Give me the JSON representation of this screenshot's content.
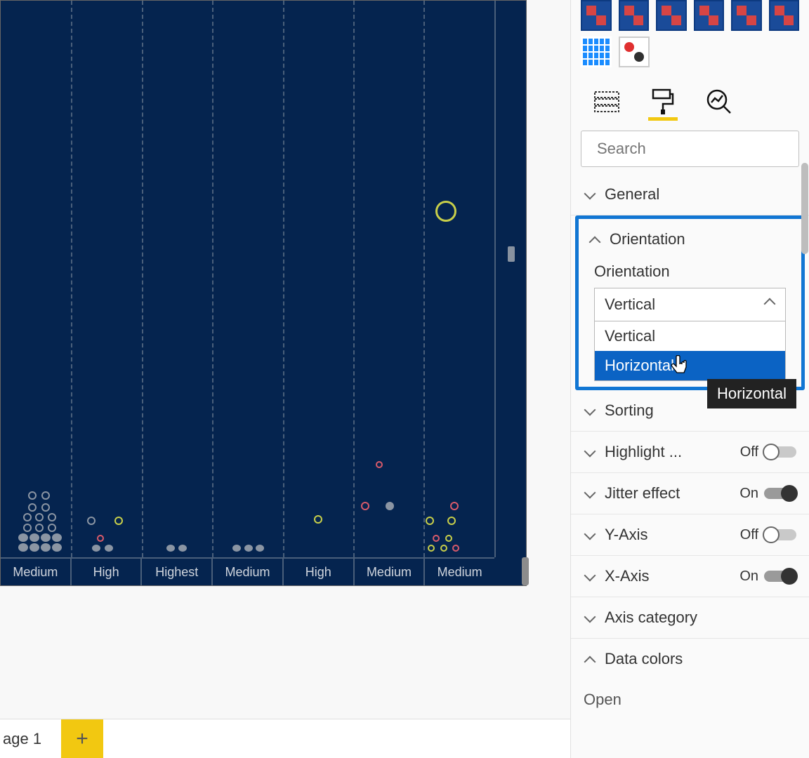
{
  "chart_data": {
    "type": "scatter",
    "title": "",
    "xlabel": "",
    "ylabel": "",
    "categories": [
      "Medium",
      "High",
      "Highest",
      "Medium",
      "High",
      "Medium",
      "Medium"
    ],
    "note": "Vertical strip/jitter plot; y positions approximate relative to full plot height (0=bottom, 1=top)",
    "series": [
      {
        "name": "grey",
        "color": "#8b95a3",
        "points": [
          {
            "cat": 0,
            "y": 0.022
          },
          {
            "cat": 0,
            "y": 0.022
          },
          {
            "cat": 0,
            "y": 0.022
          },
          {
            "cat": 0,
            "y": 0.022
          },
          {
            "cat": 0,
            "y": 0.04
          },
          {
            "cat": 0,
            "y": 0.04
          },
          {
            "cat": 0,
            "y": 0.04
          },
          {
            "cat": 0,
            "y": 0.04
          },
          {
            "cat": 0,
            "y": 0.058
          },
          {
            "cat": 0,
            "y": 0.058
          },
          {
            "cat": 0,
            "y": 0.058
          },
          {
            "cat": 0,
            "y": 0.076
          },
          {
            "cat": 0,
            "y": 0.076
          },
          {
            "cat": 0,
            "y": 0.076
          },
          {
            "cat": 0,
            "y": 0.095
          },
          {
            "cat": 0,
            "y": 0.095
          },
          {
            "cat": 0,
            "y": 0.114
          },
          {
            "cat": 0,
            "y": 0.114
          },
          {
            "cat": 1,
            "y": 0.022
          },
          {
            "cat": 1,
            "y": 0.022
          },
          {
            "cat": 2,
            "y": 0.022
          },
          {
            "cat": 2,
            "y": 0.022
          },
          {
            "cat": 3,
            "y": 0.022
          },
          {
            "cat": 3,
            "y": 0.022
          },
          {
            "cat": 3,
            "y": 0.022
          },
          {
            "cat": 5,
            "y": 0.095
          }
        ]
      },
      {
        "name": "pink",
        "color": "#d85a6a",
        "points": [
          {
            "cat": 1,
            "y": 0.04
          },
          {
            "cat": 5,
            "y": 0.095
          },
          {
            "cat": 5,
            "y": 0.2
          },
          {
            "cat": 6,
            "y": 0.04
          },
          {
            "cat": 6,
            "y": 0.095
          }
        ]
      },
      {
        "name": "yellow",
        "color": "#c8cf4a",
        "points": [
          {
            "cat": 1,
            "y": 0.072
          },
          {
            "cat": 4,
            "y": 0.075
          },
          {
            "cat": 6,
            "y": 0.022
          },
          {
            "cat": 6,
            "y": 0.04
          },
          {
            "cat": 6,
            "y": 0.022
          },
          {
            "cat": 6,
            "y": 0.072
          },
          {
            "cat": 6,
            "y": 0.072
          },
          {
            "cat": 6,
            "y": 0.615
          }
        ]
      }
    ]
  },
  "canvas": {
    "axis_labels": [
      "Medium",
      "High",
      "Highest",
      "Medium",
      "High",
      "Medium",
      "Medium"
    ]
  },
  "tabs": {
    "page": "age 1"
  },
  "search": {
    "placeholder": "Search"
  },
  "sections": {
    "general": "General",
    "orientation_header": "Orientation",
    "orientation_label": "Orientation",
    "orientation_selected": "Vertical",
    "orientation_options": [
      "Vertical",
      "Horizontal"
    ],
    "orientation_tooltip": "Horizontal",
    "sorting": "Sorting",
    "highlight": "Highlight ...",
    "jitter": "Jitter effect",
    "yaxis": "Y-Axis",
    "xaxis": "X-Axis",
    "axis_cat": "Axis category",
    "data_colors": "Data colors",
    "open": "Open"
  },
  "toggles": {
    "highlight": "Off",
    "jitter": "On",
    "yaxis": "Off",
    "xaxis": "On"
  }
}
